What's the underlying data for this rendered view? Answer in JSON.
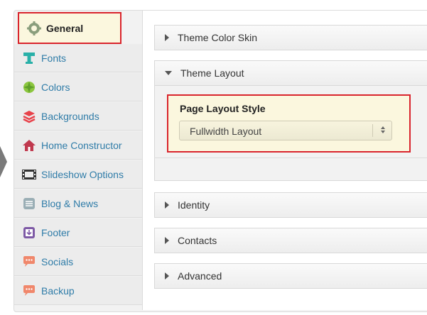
{
  "sidebar": {
    "items": [
      {
        "label": "General",
        "icon": "gear-icon"
      },
      {
        "label": "Fonts",
        "icon": "text-icon"
      },
      {
        "label": "Colors",
        "icon": "palette-icon"
      },
      {
        "label": "Backgrounds",
        "icon": "layers-icon"
      },
      {
        "label": "Home Constructor",
        "icon": "home-icon"
      },
      {
        "label": "Slideshow Options",
        "icon": "film-icon"
      },
      {
        "label": "Blog & News",
        "icon": "document-icon"
      },
      {
        "label": "Footer",
        "icon": "download-icon"
      },
      {
        "label": "Socials",
        "icon": "chat-icon"
      },
      {
        "label": "Backup",
        "icon": "chat-icon"
      }
    ],
    "active": "General"
  },
  "main": {
    "sections": [
      {
        "title": "Theme Color Skin",
        "expanded": false
      },
      {
        "title": "Theme Layout",
        "expanded": true
      },
      {
        "title": "Identity",
        "expanded": false
      },
      {
        "title": "Contacts",
        "expanded": false
      },
      {
        "title": "Advanced",
        "expanded": false
      }
    ],
    "layout_field": {
      "label": "Page Layout Style",
      "selected": "Fullwidth Layout"
    }
  },
  "colors": {
    "accent_link": "#2f7ca8",
    "highlight_border": "#d9242c",
    "highlight_bg": "#fbf7de"
  }
}
